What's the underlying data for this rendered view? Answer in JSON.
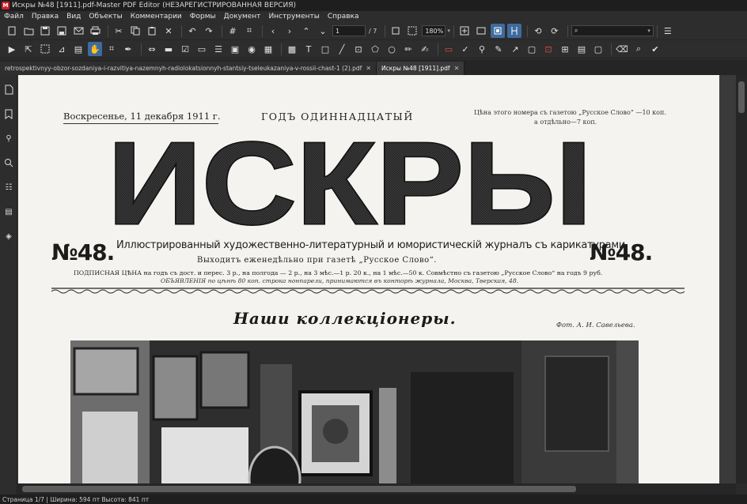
{
  "window": {
    "title": "Искры №48 [1911].pdf-Master PDF Editor (НЕЗАРЕГИСТРИРОВАННАЯ ВЕРСИЯ)",
    "logo_text": "M"
  },
  "menu": [
    "Файл",
    "Правка",
    "Вид",
    "Объекты",
    "Комментарии",
    "Формы",
    "Документ",
    "Инструменты",
    "Справка"
  ],
  "toolbar": {
    "page_current": "1",
    "page_total": "/ 7",
    "zoom": "180%",
    "search_placeholder": ""
  },
  "tabs": [
    {
      "label": "retrospektivnyy-obzor-sozdaniya-i-razvitiya-nazemnyh-radiolokatsionnyh-stantsiy-tseleukazaniya-v-rossii-chast-1 (2).pdf",
      "close": "✕"
    },
    {
      "label": "Искры №48 [1911].pdf",
      "close": "✕"
    }
  ],
  "document": {
    "date": "Воскресенье, 11 декабря 1911 г.",
    "year_line": "ГОДЪ ОДИННАДЦАТЫЙ",
    "price_line1": "Цѣна этого номера съ газетою „Русское Слово“ —10 коп.",
    "price_line2": "а отдѣльно—7 коп.",
    "masthead": "ИСКРЫ",
    "issue_left": "№48.",
    "issue_right": "№48.",
    "subtitle": "Иллюстрированный художественно-литературный и юмористическій журналъ съ карикатурами.",
    "weekly": "Выходитъ еженедѣльно при газетѣ „Русское Слово“.",
    "subscription": "ПОДПИСНАЯ ЦѢНА на годъ съ дост. и перес. 3 р., на полгода — 2 р., на 3 мѣс.—1 р. 20 к., на 1 мѣс.—50 к. Совмѣстно съ газетою „Русское Слово“ на годъ 9 руб.",
    "ads": "ОБЪЯВЛЕНІЯ по цѣнѣ 80 коп. строка нонпарели, принимаются въ конторѣ журнала, Москва, Тверская, 48.",
    "section_title": "Наши коллекціонеры.",
    "photo_credit": "Фот. А. И. Савельева."
  },
  "status": {
    "text": "Страница 1/7 | Ширина: 594 пт Высота: 841 пт"
  }
}
